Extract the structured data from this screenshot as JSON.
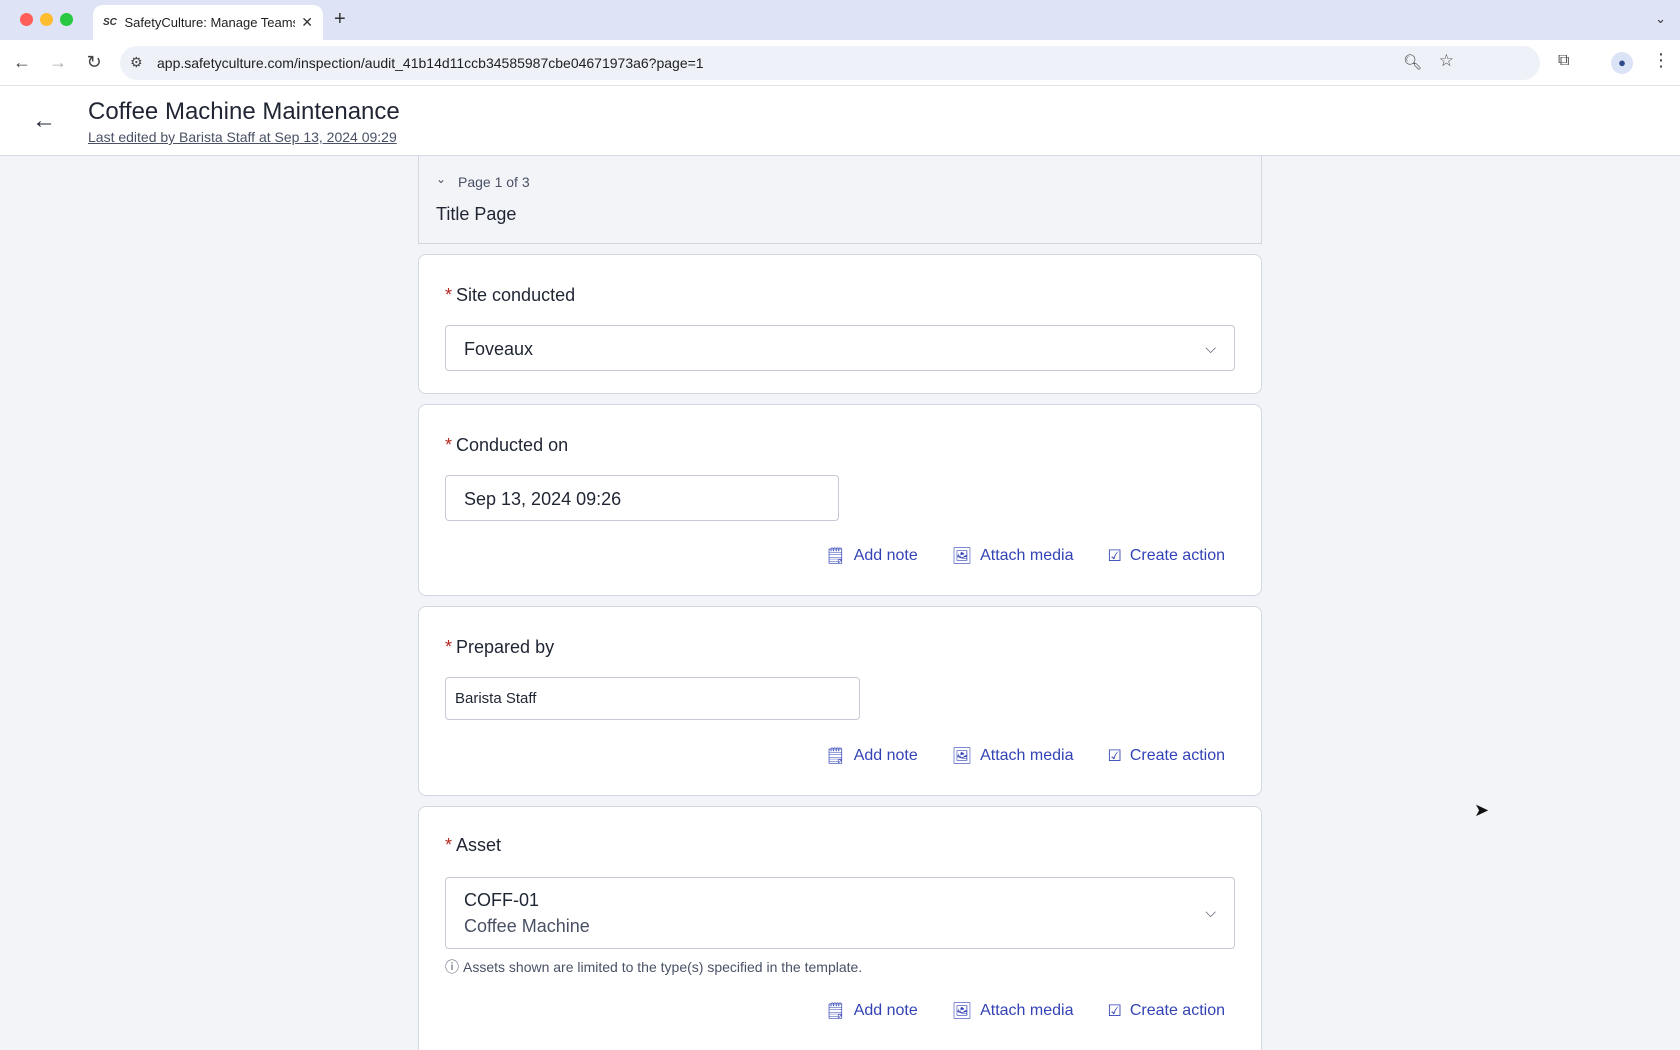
{
  "browser": {
    "tab_title": "SafetyCulture: Manage Teams",
    "tab_favicon": "SC",
    "url": "app.safetyculture.com/inspection/audit_41b14d11ccb34585987cbe04671973a6?page=1",
    "new_tab_icon": "+",
    "tab_close_icon": "✕",
    "back_icon": "←",
    "forward_icon": "→",
    "reload_icon": "↻"
  },
  "header": {
    "title": "Coffee Machine Maintenance",
    "last_edited": "Last edited by Barista Staff at Sep 13, 2024 09:29"
  },
  "page": {
    "number": "Page 1 of 3",
    "title": "Title Page"
  },
  "questions": {
    "site": {
      "label": "Site conducted",
      "value": "Foveaux"
    },
    "conducted_on": {
      "label": "Conducted on",
      "value": "Sep 13, 2024 09:26"
    },
    "prepared_by": {
      "label": "Prepared by",
      "value": "Barista Staff"
    },
    "asset": {
      "label": "Asset",
      "code": "COFF-01",
      "name": "Coffee Machine",
      "hint": "Assets shown are limited to the type(s) specified in the template."
    }
  },
  "actions": {
    "add_note": "Add note",
    "attach_media": "Attach media",
    "create_action": "Create action"
  },
  "required_marker": "*"
}
